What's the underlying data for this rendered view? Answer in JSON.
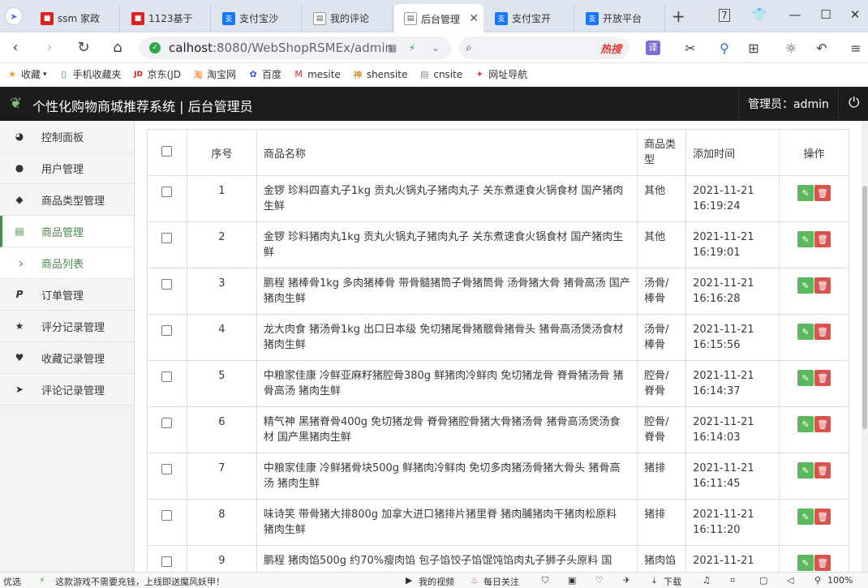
{
  "browser": {
    "tabs": [
      {
        "label": "ssm 家政",
        "icon": "red-square-icon",
        "active": false
      },
      {
        "label": "1123基于",
        "icon": "red-square-icon",
        "active": false
      },
      {
        "label": "支付宝沙",
        "icon": "alipay-icon",
        "active": false
      },
      {
        "label": "我的评论",
        "icon": "page-icon",
        "active": false
      },
      {
        "label": "后台管理",
        "icon": "page-icon",
        "active": true
      },
      {
        "label": "支付宝开",
        "icon": "alipay-icon",
        "active": false
      },
      {
        "label": "开放平台",
        "icon": "alipay-icon",
        "active": false
      }
    ],
    "new_tab": "+",
    "url_host": "calhost",
    "url_rest": ":8080/WebShopRSMEx/admin",
    "search_hot": "热搜",
    "translate_label": "译",
    "bookmarks": [
      {
        "label": "收藏",
        "icon": "star-icon"
      },
      {
        "label": "手机收藏夹",
        "icon": "phone-icon"
      },
      {
        "label": "京东(JD",
        "icon": "jd-icon"
      },
      {
        "label": "淘宝网",
        "icon": "taobao-icon"
      },
      {
        "label": "百度",
        "icon": "baidu-icon"
      },
      {
        "label": "mesite",
        "icon": "mesite-icon"
      },
      {
        "label": "shensite",
        "icon": "shensite-icon"
      },
      {
        "label": "cnsite",
        "icon": "page-icon"
      },
      {
        "label": "网址导航",
        "icon": "nav-icon"
      }
    ]
  },
  "app": {
    "title": "个性化购物商城推荐系统 | 后台管理员",
    "admin_label": "管理员：admin"
  },
  "sidebar": {
    "items": [
      {
        "label": "控制面板",
        "icon": "dashboard-icon"
      },
      {
        "label": "用户管理",
        "icon": "user-icon"
      },
      {
        "label": "商品类型管理",
        "icon": "tags-icon"
      },
      {
        "label": "商品管理",
        "icon": "list-icon",
        "active": true
      },
      {
        "label": "商品列表",
        "icon": "chevron-right-icon",
        "sub": true
      },
      {
        "label": "订单管理",
        "icon": "paypal-icon"
      },
      {
        "label": "评分记录管理",
        "icon": "star-icon"
      },
      {
        "label": "收藏记录管理",
        "icon": "heart-icon"
      },
      {
        "label": "评论记录管理",
        "icon": "send-icon"
      }
    ]
  },
  "table": {
    "headers": {
      "no": "序号",
      "name": "商品名称",
      "type": "商品类型",
      "time": "添加时间",
      "op": "操作"
    },
    "rows": [
      {
        "no": "1",
        "name": "金锣 珍料四喜丸子1kg 贡丸火锅丸子猪肉丸子 关东煮速食火锅食材 国产猪肉生鲜",
        "type": "其他",
        "time": "2021-11-21 16:19:24"
      },
      {
        "no": "2",
        "name": "金锣 珍料猪肉丸1kg 贡丸火锅丸子猪肉丸子 关东煮速食火锅食材 国产猪肉生鲜",
        "type": "其他",
        "time": "2021-11-21 16:19:01"
      },
      {
        "no": "3",
        "name": "鹏程 猪棒骨1kg 多肉猪棒骨 带骨髓猪筒子骨猪筒骨 汤骨猪大骨 猪骨高汤 国产猪肉生鲜",
        "type": "汤骨/棒骨",
        "time": "2021-11-21 16:16:28"
      },
      {
        "no": "4",
        "name": "龙大肉食 猪汤骨1kg 出口日本级 免切猪尾骨猪髋骨猪骨头 猪骨高汤煲汤食材 猪肉生鲜",
        "type": "汤骨/棒骨",
        "time": "2021-11-21 16:15:56"
      },
      {
        "no": "5",
        "name": "中粮家佳康 冷鲜亚麻籽猪腔骨380g 鲜猪肉冷鲜肉 免切猪龙骨 脊骨猪汤骨 猪骨高汤 猪肉生鲜",
        "type": "腔骨/脊骨",
        "time": "2021-11-21 16:14:37"
      },
      {
        "no": "6",
        "name": "精气神 黑猪脊骨400g 免切猪龙骨 脊骨猪腔骨猪大骨猪汤骨 猪骨高汤煲汤食材 国产黑猪肉生鲜",
        "type": "腔骨/脊骨",
        "time": "2021-11-21 16:14:03"
      },
      {
        "no": "7",
        "name": "中粮家佳康 冷鲜猪骨块500g 鲜猪肉冷鲜肉 免切多肉猪汤骨猪大骨头 猪骨高汤 猪肉生鲜",
        "type": "猪排",
        "time": "2021-11-21 16:11:45"
      },
      {
        "no": "8",
        "name": "味诗笑 带骨猪大排800g 加拿大进口猪排片猪里脊 猪肉脯猪肉干猪肉松原料 猪肉生鲜",
        "type": "猪排",
        "time": "2021-11-21 16:11:20"
      },
      {
        "no": "9",
        "name": "鹏程 猪肉馅500g 约70%瘦肉馅 包子馅饺子馅馄饨馅肉丸子狮子头原料 国",
        "type": "猪肉馅",
        "time": "2021-11-21"
      }
    ]
  },
  "statusbar": {
    "left_label": "优选",
    "ad": "这款游戏不需要充钱，上线即送魔风妖甲！",
    "video": "我的视频",
    "daily": "每日关注",
    "download": "下载",
    "zoom": "100%"
  }
}
